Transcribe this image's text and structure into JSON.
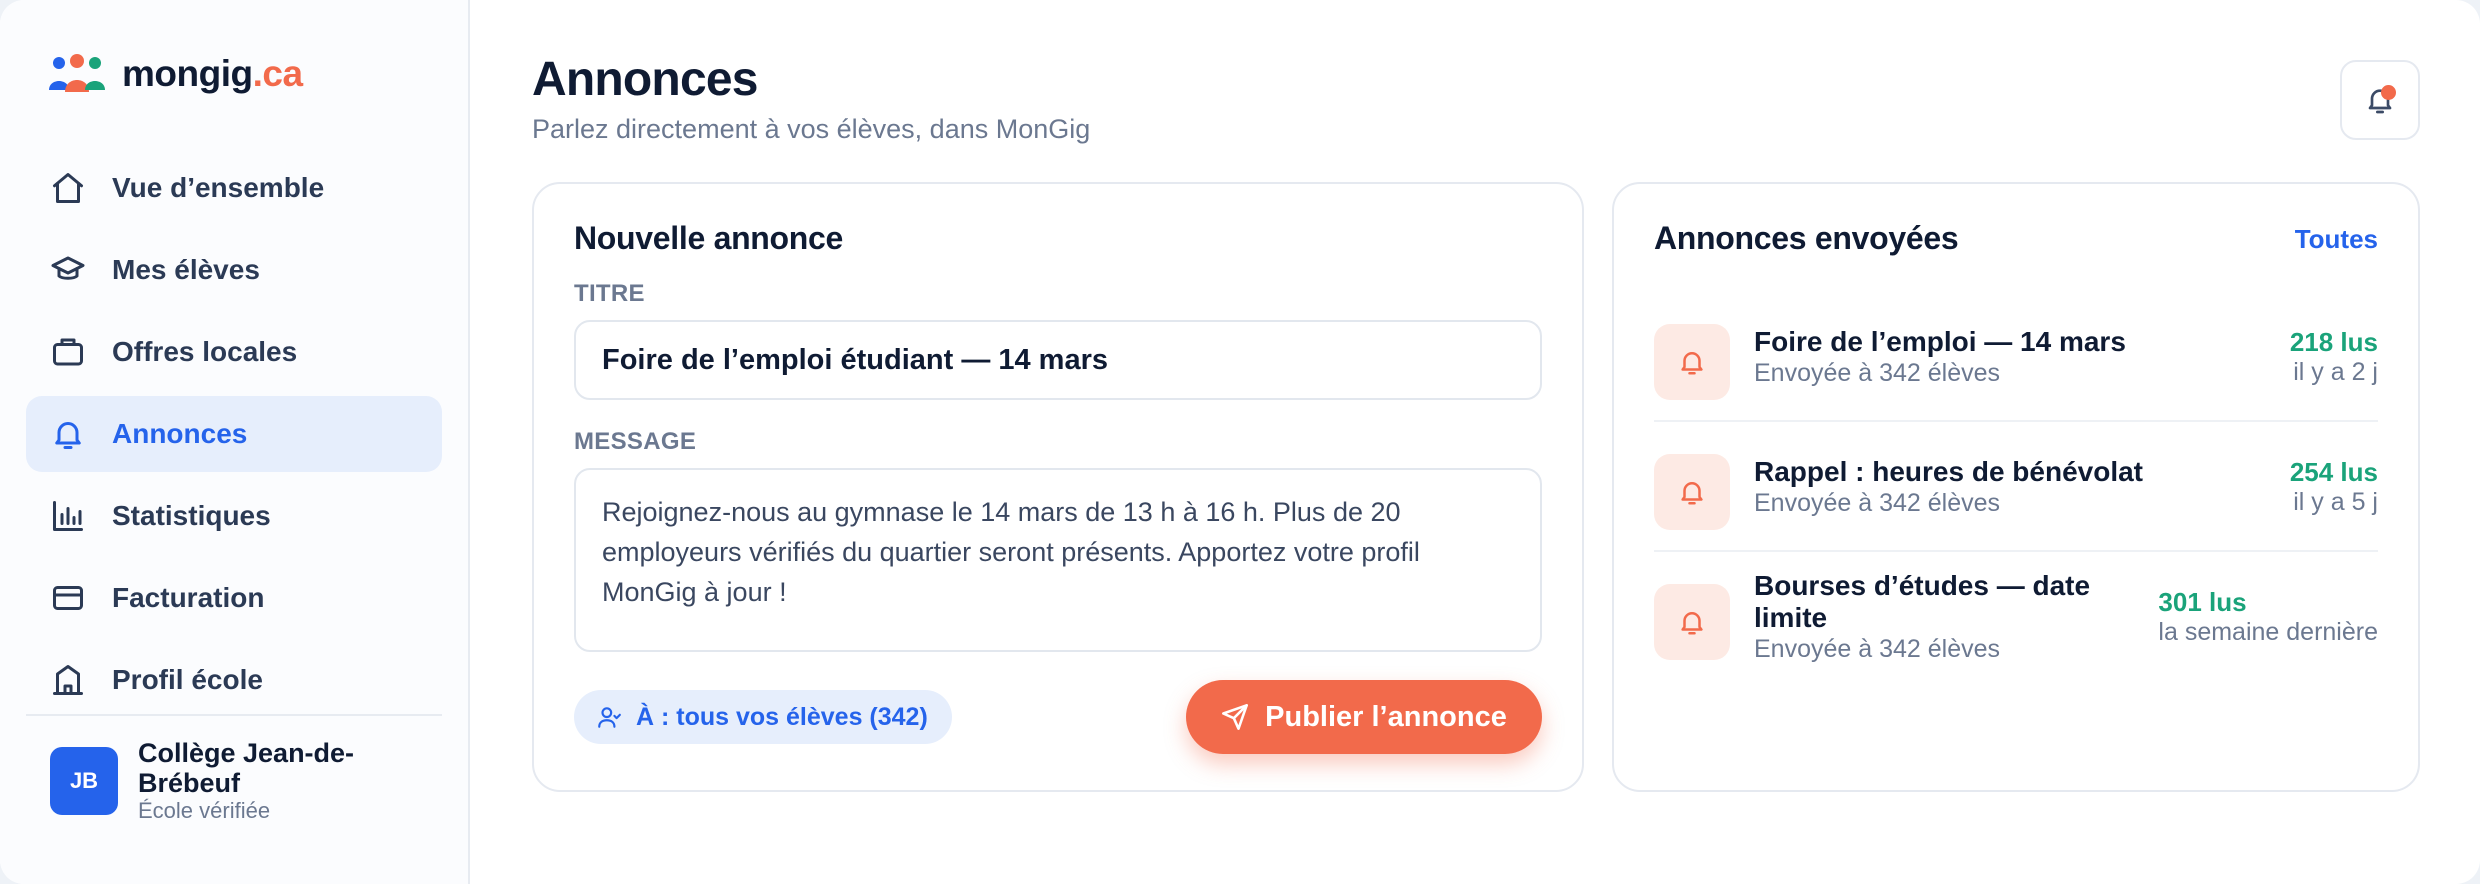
{
  "brand": {
    "name": "mongig",
    "tld": ".ca",
    "logo_icon": "people-group-icon"
  },
  "sidebar": {
    "items": [
      {
        "label": "Vue d’ensemble",
        "icon": "home-icon",
        "active": false
      },
      {
        "label": "Mes élèves",
        "icon": "graduation-cap-icon",
        "active": false
      },
      {
        "label": "Offres locales",
        "icon": "briefcase-icon",
        "active": false
      },
      {
        "label": "Annonces",
        "icon": "bell-icon",
        "active": true
      },
      {
        "label": "Statistiques",
        "icon": "bar-chart-icon",
        "active": false
      },
      {
        "label": "Facturation",
        "icon": "credit-card-icon",
        "active": false
      },
      {
        "label": "Profil école",
        "icon": "school-building-icon",
        "active": false
      }
    ],
    "school": {
      "initials": "JB",
      "name": "Collège Jean-de-Brébeuf",
      "status": "École vérifiée"
    }
  },
  "header": {
    "title": "Annonces",
    "subtitle": "Parlez directement à vos élèves, dans MonGig",
    "notification_icon": "bell-icon"
  },
  "compose": {
    "title": "Nouvelle annonce",
    "title_label": "TITRE",
    "title_value": "Foire de l’emploi étudiant — 14 mars",
    "message_label": "MESSAGE",
    "message_value": "Rejoignez-nous au gymnase le 14 mars de 13 h à 16 h. Plus de 20 employeurs vérifiés du quartier seront présents. Apportez votre profil MonGig à jour !",
    "audience_label": "À : tous vos élèves (342)",
    "publish_label": "Publier l’annonce"
  },
  "sent": {
    "title": "Annonces envoyées",
    "see_all": "Toutes",
    "items": [
      {
        "title": "Foire de l’emploi — 14 mars",
        "recipients": "Envoyée à 342 élèves",
        "reads": "218 lus",
        "when": "il y a 2 j"
      },
      {
        "title": "Rappel : heures de bénévolat",
        "recipients": "Envoyée à 342 élèves",
        "reads": "254 lus",
        "when": "il y a 5 j"
      },
      {
        "title": "Bourses d’études — date limite",
        "recipients": "Envoyée à 342 élèves",
        "reads": "301 lus",
        "when": "la semaine dernière"
      }
    ]
  },
  "colors": {
    "accent": "#f26a4b",
    "primary": "#2563eb",
    "success": "#1aa37a",
    "text": "#0f1b33",
    "muted": "#6b7890"
  }
}
